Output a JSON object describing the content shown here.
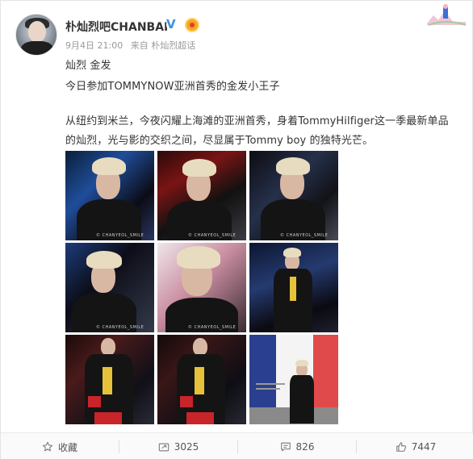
{
  "post": {
    "username": "朴灿烈吧CHANBAR",
    "verified_mark": "V",
    "date": "9月4日 21:00",
    "source_prefix": "来自",
    "source": "朴灿烈超话",
    "lines": [
      "灿烈 金发",
      "今日参加TOMMYNOW亚洲首秀的金发小王子",
      "从纽约到米兰，今夜闪耀上海滩的亚洲首秀，身着TommyHilfiger这一季最新单品",
      "的灿烈，光与影的交织之间，尽显属于Tommy boy 的独特光芒。"
    ],
    "watermark": "© CHANYEOL_SMILE",
    "photos": [
      "photo-1",
      "photo-2",
      "photo-3",
      "photo-4",
      "photo-5",
      "photo-6",
      "photo-7",
      "photo-8",
      "photo-9"
    ]
  },
  "actions": {
    "favorite_label": "收藏",
    "repost_count": "3025",
    "comment_count": "826",
    "like_count": "7447"
  },
  "icons": {
    "favorite": "star-icon",
    "repost": "repost-icon",
    "comment": "comment-icon",
    "like": "thumbs-up-icon"
  },
  "colors": {
    "verified": "#3d91e0",
    "medal": "#f6a623",
    "meta": "#999999",
    "text": "#333333"
  }
}
